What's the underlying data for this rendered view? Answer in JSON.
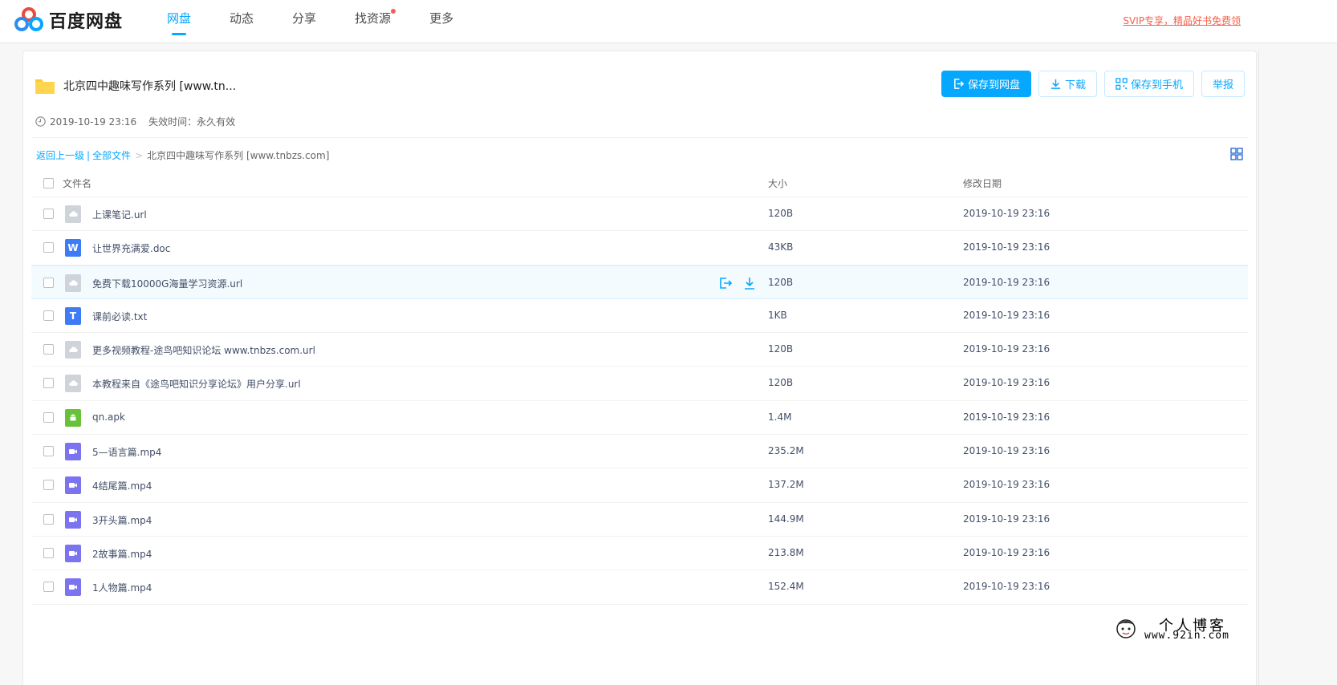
{
  "header": {
    "logo_text": "百度网盘",
    "nav": [
      {
        "label": "网盘",
        "active": true,
        "dot": false
      },
      {
        "label": "动态",
        "active": false,
        "dot": false
      },
      {
        "label": "分享",
        "active": false,
        "dot": false
      },
      {
        "label": "找资源",
        "active": false,
        "dot": true
      },
      {
        "label": "更多",
        "active": false,
        "dot": false
      }
    ],
    "svip_link": "SVIP专享，精品好书免费领"
  },
  "share": {
    "title": "北京四中趣味写作系列 [www.tn...",
    "created": "2019-10-19 23:16",
    "expire": "失效时间：永久有效"
  },
  "actions": {
    "save": "保存到网盘",
    "download": "下载",
    "save_phone": "保存到手机",
    "report": "举报"
  },
  "breadcrumb": {
    "back": "返回上一级",
    "all": "全部文件",
    "sep": ">",
    "current": "北京四中趣味写作系列 [www.tnbzs.com]"
  },
  "table": {
    "headers": {
      "name": "文件名",
      "size": "大小",
      "date": "修改日期"
    },
    "rows": [
      {
        "name": "上课笔记.url",
        "size": "120B",
        "date": "2019-10-19 23:16",
        "type": "url",
        "icon_text": ""
      },
      {
        "name": "让世界充满爱.doc",
        "size": "43KB",
        "date": "2019-10-19 23:16",
        "type": "doc",
        "icon_text": "W"
      },
      {
        "name": "免费下载10000G海量学习资源.url",
        "size": "120B",
        "date": "2019-10-19 23:16",
        "type": "url",
        "icon_text": ""
      },
      {
        "name": "课前必读.txt",
        "size": "1KB",
        "date": "2019-10-19 23:16",
        "type": "txt",
        "icon_text": "T"
      },
      {
        "name": "更多视频教程-途鸟吧知识论坛 www.tnbzs.com.url",
        "size": "120B",
        "date": "2019-10-19 23:16",
        "type": "url",
        "icon_text": ""
      },
      {
        "name": "本教程来自《途鸟吧知识分享论坛》用户分享.url",
        "size": "120B",
        "date": "2019-10-19 23:16",
        "type": "url",
        "icon_text": ""
      },
      {
        "name": "qn.apk",
        "size": "1.4M",
        "date": "2019-10-19 23:16",
        "type": "apk",
        "icon_text": ""
      },
      {
        "name": "5—语言篇.mp4",
        "size": "235.2M",
        "date": "2019-10-19 23:16",
        "type": "mp4",
        "icon_text": ""
      },
      {
        "name": "4结尾篇.mp4",
        "size": "137.2M",
        "date": "2019-10-19 23:16",
        "type": "mp4",
        "icon_text": ""
      },
      {
        "name": "3开头篇.mp4",
        "size": "144.9M",
        "date": "2019-10-19 23:16",
        "type": "mp4",
        "icon_text": ""
      },
      {
        "name": "2故事篇.mp4",
        "size": "213.8M",
        "date": "2019-10-19 23:16",
        "type": "mp4",
        "icon_text": ""
      },
      {
        "name": "1人物篇.mp4",
        "size": "152.4M",
        "date": "2019-10-19 23:16",
        "type": "mp4",
        "icon_text": ""
      }
    ]
  },
  "watermark": {
    "title": "个人博客",
    "url": "www.92in.com"
  },
  "colors": {
    "accent": "#06a7ff",
    "svip": "#f5614b",
    "folder": "#ffca28",
    "video": "#7c73f0",
    "apk": "#67c23a",
    "doc": "#3d7bf7",
    "url": "#cfd3da"
  }
}
